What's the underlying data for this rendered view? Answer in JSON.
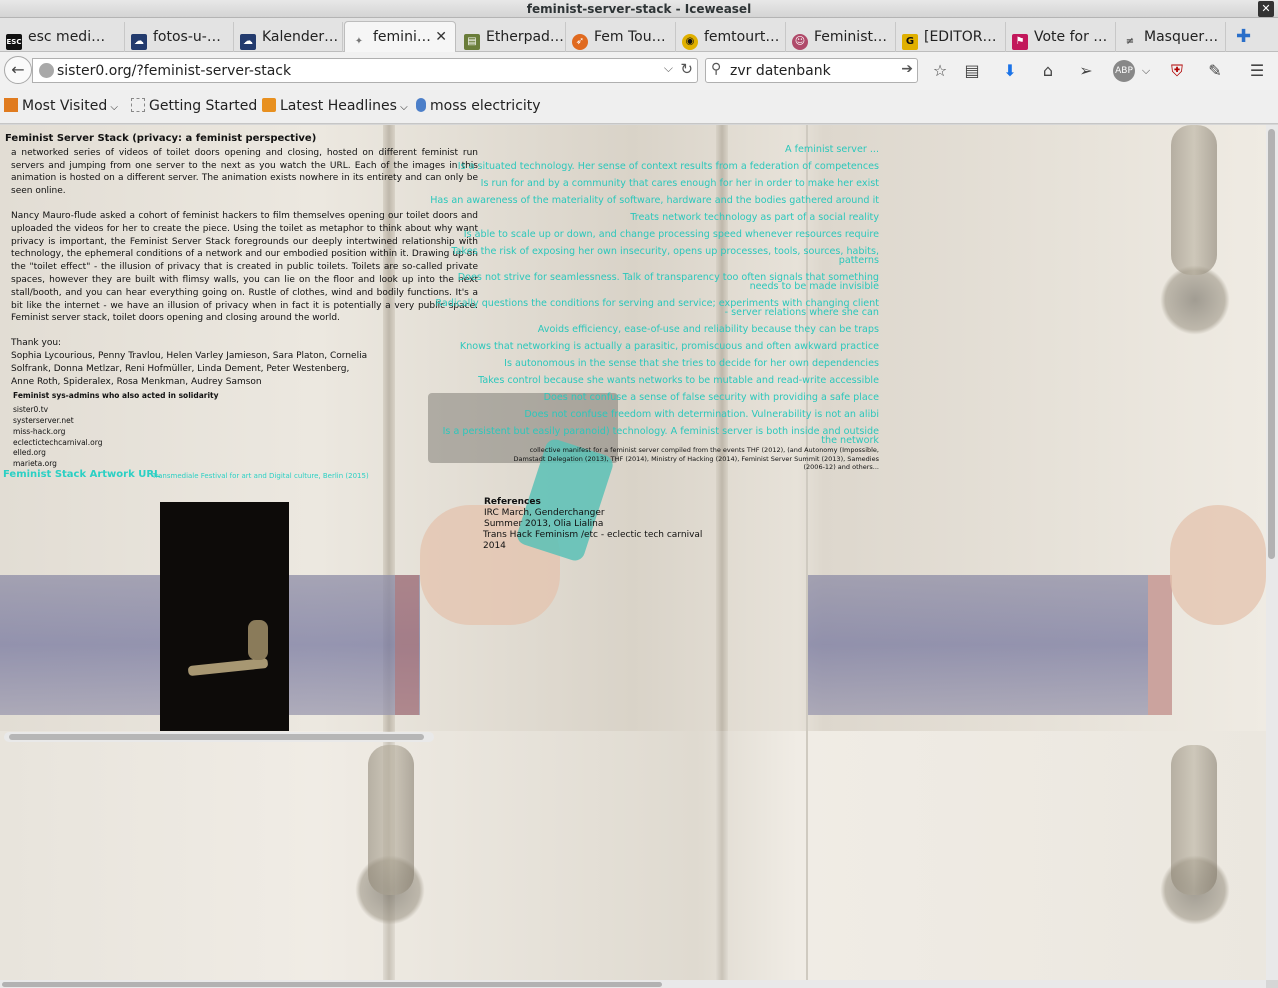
{
  "window": {
    "title": "feminist-server-stack - Iceweasel"
  },
  "tabs": [
    {
      "label": "esc medi…",
      "favicon": "esc-icon",
      "color": "#111111"
    },
    {
      "label": "fotos-u-…",
      "favicon": "cloud-icon",
      "color": "#233b6e"
    },
    {
      "label": "Kalender…",
      "favicon": "cloud-icon",
      "color": "#233b6e"
    },
    {
      "label": "femini…",
      "favicon": "sparkle-icon",
      "color": "#777777",
      "active": true
    },
    {
      "label": "Etherpad…",
      "favicon": "pad-icon",
      "color": "#6a7d3a"
    },
    {
      "label": "Fem Tou…",
      "favicon": "rocket-icon",
      "color": "#e06a1f"
    },
    {
      "label": "femtourt…",
      "favicon": "mask-icon",
      "color": "#e0b000"
    },
    {
      "label": "Feminist…",
      "favicon": "face-icon",
      "color": "#b04a6a"
    },
    {
      "label": "[EDITOR…",
      "favicon": "g-icon",
      "color": "#e0b000"
    },
    {
      "label": "Vote for …",
      "favicon": "flag-icon",
      "color": "#c2185b"
    },
    {
      "label": "Masquer…",
      "favicon": "strike-icon",
      "color": "#555555"
    }
  ],
  "navbar": {
    "url": "sister0.org/?feminist-server-stack",
    "search": "zvr datenbank"
  },
  "bookmarks": [
    {
      "label": "Most Visited",
      "has_dropdown": true
    },
    {
      "label": "Getting Started",
      "has_dropdown": false
    },
    {
      "label": "Latest Headlines",
      "has_dropdown": true
    },
    {
      "label": "moss electricity",
      "has_dropdown": false
    }
  ],
  "page": {
    "title": "Feminist Server Stack (privacy: a feminist perspective)",
    "intro": "a networked series of videos of toilet doors opening and closing, hosted on different feminist run servers and jumping from one server to the next as you watch the URL. Each of the images in this animation is hosted on a different server. The animation exists nowhere in its entirety and can only be seen online.",
    "body": "Nancy Mauro-flude asked a cohort of feminist hackers to film themselves opening our toilet doors and uploaded the videos for her to create the piece. Using the toilet as metaphor to think about why want privacy is important, the Feminist Server Stack foregrounds our deeply intertwined relationship with technology, the ephemeral conditions of a network and our embodied position within it. Drawing up on the \"toilet effect\" - the illusion of privacy that is created in public toilets. Toilets are so-called private spaces, however they are built with flimsy walls, you can lie on the floor and look up into the next stall/booth, and you can hear everything going on. Rustle of clothes, wind and bodily functions. It's a bit like the internet - we have an illusion of privacy when in fact it is potentially a very public space. Feminist server stack, toilet doors opening and closing around the world.",
    "thanks_label": "Thank you:",
    "thanks_names": "Sophia Lycourious, Penny Travlou, Helen Varley Jamieson, Sara Platon, Cornelia Solfrank, Donna Metlzar, Reni Hofmüller, Linda Dement, Peter Westenberg, Anne Roth, Spideralex, Rosa Menkman, Audrey Samson",
    "sysadmin_title": "Feminist sys-admins who also acted in solidarity",
    "sysadmins": [
      "sister0.tv",
      "systerserver.net",
      "miss-hack.org",
      "eclectictechcarnival.org",
      "elled.org",
      "marieta.org"
    ],
    "artwork_link": "Feminist Stack Artwork URL",
    "festival": "Transmediale Festival for art and Digital culture, Berlin (2015)",
    "manifesto": [
      "A feminist server ...",
      "Is a situated technology. Her sense of context results from a federation of competences",
      "Is run for and by a community that cares enough for her in order to make her exist",
      "Has an awareness of the materiality of software, hardware and the bodies gathered around it",
      "Treats network technology as part of a social reality",
      "Is able to scale up or down, and change processing speed whenever resources require",
      "Takes the risk of exposing her own insecurity, opens up processes, tools, sources, habits, patterns",
      "Does not strive for seamlessness. Talk of transparency too often signals that something needs to be made invisible",
      "Radically questions the conditions for serving and service; experiments with changing client - server relations where she can",
      "Avoids efficiency, ease-of-use and reliability because they can be traps",
      "Knows that networking is actually a parasitic, promiscuous and often awkward practice",
      "Is autonomous in the sense that she tries to decide for her own dependencies",
      "Takes control because she wants networks to be mutable and read-write accessible",
      "Does not confuse a sense of false security with providing a safe place",
      "Does not confuse freedom with determination. Vulnerability is not an alibi",
      "Is a persistent but easily paranoid) technology. A feminist server is both inside and outside the network"
    ],
    "manifesto_note": "collective manifest for a feminist server compiled from the events THF (2012), (and Autonomy (Impossible, Damstadt Delegation (2013), THF (2014), Ministry of Hacking (2014), Feminist Server Summit (2013), Samedies (2006-12) and others...",
    "references_title": "References",
    "references": [
      "IRC March, Genderchanger",
      "Summer 2013, Olia Lialina",
      "Trans Hack Feminism /etc - eclectic tech carnival",
      "2014"
    ]
  }
}
